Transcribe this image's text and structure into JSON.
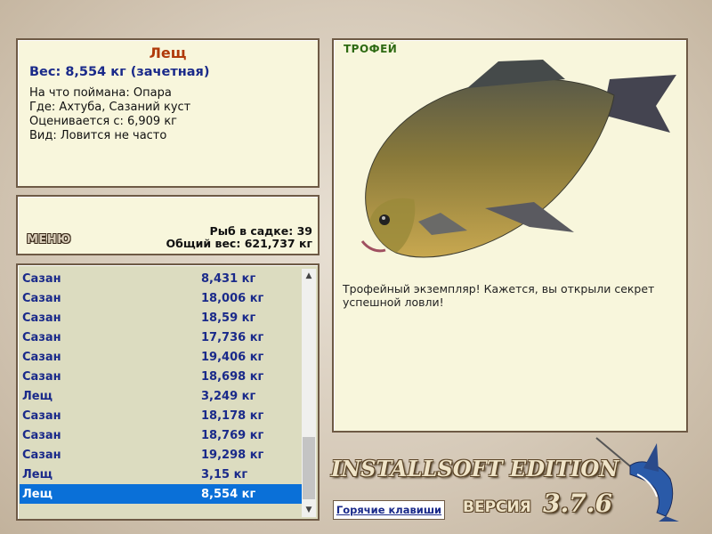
{
  "fish": {
    "name": "Лещ",
    "weight_line": "Вес: 8,554 кг (зачетная)",
    "bait_line": "На что поймана: Опара",
    "place_line": "Где: Ахтуба, Сазаний куст",
    "rated_line": "Оценивается с: 6,909 кг",
    "kind_line": "Вид: Ловится не часто"
  },
  "summary": {
    "menu_label": "МЕНЮ",
    "count_line": "Рыб в садке: 39",
    "total_line": "Общий вес: 621,737 кг"
  },
  "catch_list": [
    {
      "name": "Сазан",
      "weight": "8,431 кг"
    },
    {
      "name": "Сазан",
      "weight": "18,006 кг"
    },
    {
      "name": "Сазан",
      "weight": "18,59 кг"
    },
    {
      "name": "Сазан",
      "weight": "17,736 кг"
    },
    {
      "name": "Сазан",
      "weight": "19,406 кг"
    },
    {
      "name": "Сазан",
      "weight": "18,698 кг"
    },
    {
      "name": "Лещ",
      "weight": "3,249 кг"
    },
    {
      "name": "Сазан",
      "weight": "18,178 кг"
    },
    {
      "name": "Сазан",
      "weight": "18,769 кг"
    },
    {
      "name": "Сазан",
      "weight": "19,298 кг"
    },
    {
      "name": "Лещ",
      "weight": "3,15 кг"
    },
    {
      "name": "Лещ",
      "weight": "8,554 кг",
      "selected": true
    }
  ],
  "trophy": {
    "label": "ТРОФЕЙ",
    "description": "Трофейный экземпляр! Кажется, вы открыли секрет успешной ловли!"
  },
  "footer": {
    "hotkeys_label": "Горячие клавиши",
    "edition": "INSTALLSOFT EDITION",
    "version_label": "ВЕРСИЯ",
    "version_number": "3.7.6"
  },
  "colors": {
    "panel_bg": "#f8f6dc",
    "selection": "#0a70d8",
    "title_red": "#b03a0a",
    "list_blue": "#1a2a8a"
  }
}
